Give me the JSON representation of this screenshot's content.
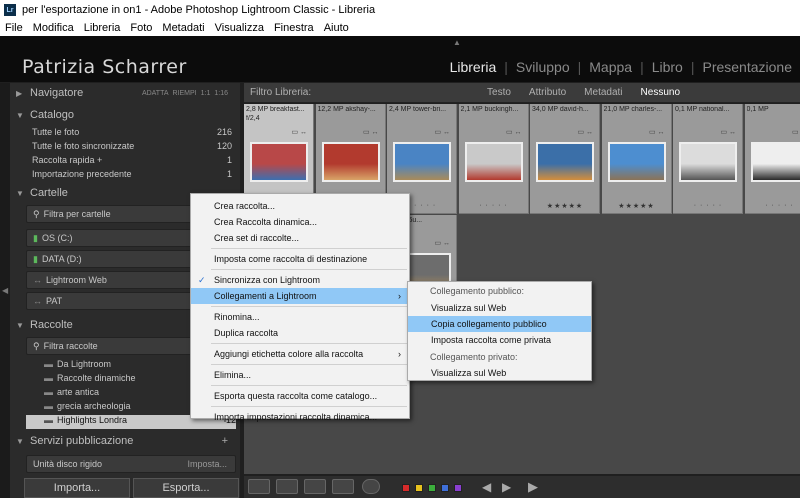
{
  "window": {
    "title": "per l'esportazione in on1 - Adobe Photoshop Lightroom Classic - Libreria",
    "app_badge": "Lr"
  },
  "menubar": [
    "File",
    "Modifica",
    "Libreria",
    "Foto",
    "Metadati",
    "Visualizza",
    "Finestra",
    "Aiuto"
  ],
  "identity_plate": "Patrizia Scharrer",
  "modules": [
    "Libreria",
    "Sviluppo",
    "Mappa",
    "Libro",
    "Presentazione"
  ],
  "active_module": "Libreria",
  "navigator": {
    "title": "Navigatore",
    "options": [
      "ADATTA",
      "RIEMPI",
      "1:1",
      "1:16"
    ]
  },
  "catalog": {
    "title": "Catalogo",
    "rows": [
      {
        "label": "Tutte le foto",
        "count": "216"
      },
      {
        "label": "Tutte le foto sincronizzate",
        "count": "120"
      },
      {
        "label": "Raccolta rapida +",
        "count": "1"
      },
      {
        "label": "Importazione precedente",
        "count": "1"
      }
    ]
  },
  "folders": {
    "title": "Cartelle",
    "filter": "Filtra per cartelle",
    "volumes": [
      "OS (C:)",
      "DATA (D:)",
      "Lightroom Web",
      "PAT"
    ]
  },
  "collections": {
    "title": "Raccolte",
    "filter": "Filtra raccolte",
    "items": [
      {
        "label": "Da Lightroom",
        "count": ""
      },
      {
        "label": "Raccolte dinamiche",
        "count": ""
      },
      {
        "label": "arte antica",
        "count": ""
      },
      {
        "label": "grecia archeologia",
        "count": ""
      },
      {
        "label": "Highlights Londra",
        "count": "12"
      }
    ]
  },
  "publish": {
    "title": "Servizi pubblicazione",
    "service": "Unità disco rigido",
    "action": "Imposta..."
  },
  "bottom_buttons": {
    "import": "Importa...",
    "export": "Esporta..."
  },
  "filter_bar": {
    "label": "Filtro Libreria:",
    "options": [
      "Testo",
      "Attributo",
      "Metadati",
      "Nessuno"
    ],
    "active": "Nessuno"
  },
  "thumbnails": [
    {
      "meta": "2,8 MP  breakfast...",
      "sub": "f/2,4",
      "stars": "",
      "color": "#b84848",
      "color2": "#3d6fb0"
    },
    {
      "meta": "12,2 MP  akshay-...",
      "sub": "",
      "stars": "· · · · ·",
      "color": "#b23a2e",
      "color2": "#d9a468"
    },
    {
      "meta": "2,4 MP  tower-bri...",
      "sub": "",
      "stars": "· · · · ·",
      "color": "#4a84c4",
      "color2": "#a98b5a"
    },
    {
      "meta": "2,1 MP  buckingh...",
      "sub": "",
      "stars": "· · · · ·",
      "color": "#c9c9c9",
      "color2": "#b23a2e"
    },
    {
      "meta": "34,0 MP  david-h...",
      "sub": "",
      "stars": "★★★★★",
      "color": "#3b6fa8",
      "color2": "#d38e3c"
    },
    {
      "meta": "21,0 MP  charles-...",
      "sub": "",
      "stars": "★★★★★",
      "color": "#4d8ed0",
      "color2": "#8b7357"
    },
    {
      "meta": "0,1 MP  national...",
      "sub": "",
      "stars": "· · · · ·",
      "color": "#dcdcdc",
      "color2": "#555"
    },
    {
      "meta": "0,1 MP",
      "sub": "",
      "stars": "· · · · ·",
      "color": "#eee",
      "color2": "#2a2a2a"
    },
    {
      "meta": "",
      "sub": "",
      "stars": "",
      "color": "#9a9a9a",
      "color2": "#9a9a9a"
    },
    {
      "meta": "",
      "sub": "",
      "stars": "",
      "color": "#9a9a9a",
      "color2": "#9a9a9a"
    },
    {
      "meta": "092216u...",
      "sub": "",
      "stars": "",
      "color": "#6d6d6d",
      "color2": "#b0905e"
    }
  ],
  "context_menu": {
    "items": [
      {
        "label": "Crea raccolta...",
        "type": "item"
      },
      {
        "label": "Crea Raccolta dinamica...",
        "type": "item"
      },
      {
        "label": "Crea set di raccolte...",
        "type": "item"
      },
      {
        "type": "sep"
      },
      {
        "label": "Imposta come raccolta di destinazione",
        "type": "item"
      },
      {
        "type": "sep"
      },
      {
        "label": "Sincronizza con Lightroom",
        "type": "item",
        "check": "✓"
      },
      {
        "label": "Collegamenti a Lightroom",
        "type": "item",
        "hl": true,
        "arrow": "›"
      },
      {
        "type": "sep"
      },
      {
        "label": "Rinomina...",
        "type": "item"
      },
      {
        "label": "Duplica raccolta",
        "type": "item"
      },
      {
        "type": "sep"
      },
      {
        "label": "Aggiungi etichetta colore alla raccolta",
        "type": "item",
        "arrow": "›"
      },
      {
        "type": "sep"
      },
      {
        "label": "Elimina...",
        "type": "item"
      },
      {
        "type": "sep"
      },
      {
        "label": "Esporta questa raccolta come catalogo...",
        "type": "item"
      },
      {
        "type": "sep"
      },
      {
        "label": "Importa impostazioni raccolta dinamica...",
        "type": "item"
      }
    ]
  },
  "submenu": {
    "public_heading": "Collegamento pubblico:",
    "public_items": [
      "Visualizza sul Web",
      "Copia collegamento pubblico",
      "Imposta raccolta come privata"
    ],
    "private_heading": "Collegamento privato:",
    "private_items": [
      "Visualizza sul Web"
    ],
    "highlighted": "Copia collegamento pubblico"
  },
  "color_labels": [
    "#d62b2b",
    "#e8c21e",
    "#3cae3c",
    "#3f6fd8",
    "#8a3fd0"
  ]
}
